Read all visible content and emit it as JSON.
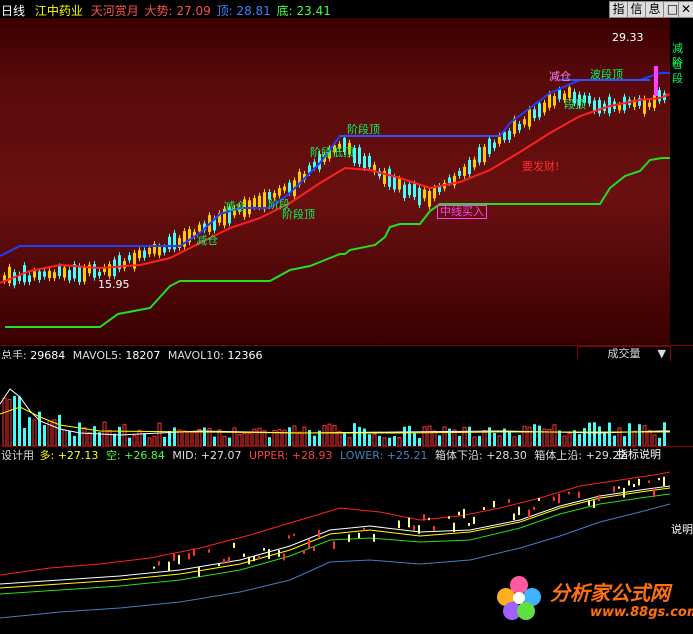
{
  "header": {
    "period": "日线",
    "stock_name": "江中药业",
    "indicator_name": "天河赏月",
    "trend_label": "大势: 27.09",
    "top_label": "顶: 28.81",
    "bottom_label": "底: 23.41",
    "buttons": [
      "指",
      "信",
      "息"
    ],
    "window_controls": [
      "□",
      "✕"
    ]
  },
  "main_chart": {
    "price_high_label": "29.33",
    "price_low_label": "15.95",
    "annotations": [
      "减仓",
      "减仓",
      "阶段",
      "阶段顶",
      "阶段顶",
      "阶段低顶",
      "减仓",
      "波段顶",
      "段顶",
      "要发财!",
      "中线买入",
      "减仓",
      "阶段"
    ],
    "colors": {
      "ma_red": "#ff2020",
      "ma_blue": "#2040ff",
      "support_green": "#20e020",
      "up_candle": "#ffcc00",
      "down_candle": "#44ffff"
    }
  },
  "volume": {
    "label_total": "总手:",
    "total_value": "29684",
    "mavol5_label": "MAVOL5:",
    "mavol5_value": "18207",
    "mavol10_label": "MAVOL10:",
    "mavol10_value": "12366",
    "dropdown_label": "成交量"
  },
  "indicator": {
    "name": "设计用",
    "duo_label": "多:",
    "duo_value": "+27.13",
    "kong_label": "空:",
    "kong_value": "+26.84",
    "mid_label": "MID:",
    "mid_value": "+27.07",
    "upper_label": "UPPER:",
    "upper_value": "+28.93",
    "lower_label": "LOWER:",
    "lower_value": "+25.21",
    "box_lower_label": "箱体下沿:",
    "box_lower_value": "+28.30",
    "box_upper_label": "箱体上沿:",
    "box_upper_value": "+29.22",
    "help_button": "指标说明",
    "side_note": "说明"
  },
  "watermark": {
    "brand": "分析家公式网",
    "url": "www.88gs.com"
  }
}
